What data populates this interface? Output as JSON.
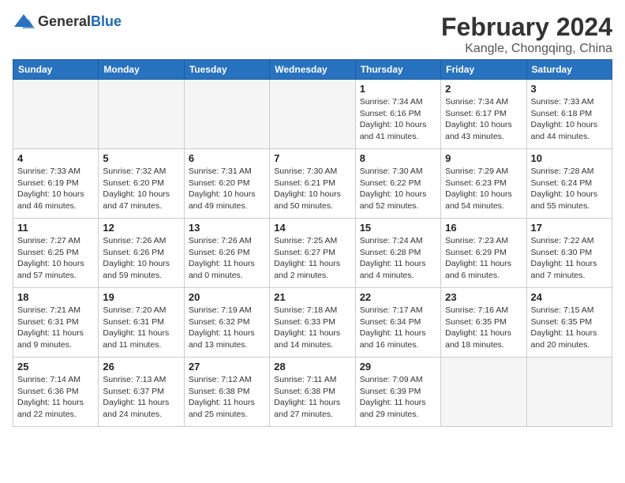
{
  "logo": {
    "general": "General",
    "blue": "Blue"
  },
  "title": "February 2024",
  "subtitle": "Kangle, Chongqing, China",
  "days_of_week": [
    "Sunday",
    "Monday",
    "Tuesday",
    "Wednesday",
    "Thursday",
    "Friday",
    "Saturday"
  ],
  "weeks": [
    [
      {
        "day": "",
        "info": ""
      },
      {
        "day": "",
        "info": ""
      },
      {
        "day": "",
        "info": ""
      },
      {
        "day": "",
        "info": ""
      },
      {
        "day": "1",
        "info": "Sunrise: 7:34 AM\nSunset: 6:16 PM\nDaylight: 10 hours and 41 minutes."
      },
      {
        "day": "2",
        "info": "Sunrise: 7:34 AM\nSunset: 6:17 PM\nDaylight: 10 hours and 43 minutes."
      },
      {
        "day": "3",
        "info": "Sunrise: 7:33 AM\nSunset: 6:18 PM\nDaylight: 10 hours and 44 minutes."
      }
    ],
    [
      {
        "day": "4",
        "info": "Sunrise: 7:33 AM\nSunset: 6:19 PM\nDaylight: 10 hours and 46 minutes."
      },
      {
        "day": "5",
        "info": "Sunrise: 7:32 AM\nSunset: 6:20 PM\nDaylight: 10 hours and 47 minutes."
      },
      {
        "day": "6",
        "info": "Sunrise: 7:31 AM\nSunset: 6:20 PM\nDaylight: 10 hours and 49 minutes."
      },
      {
        "day": "7",
        "info": "Sunrise: 7:30 AM\nSunset: 6:21 PM\nDaylight: 10 hours and 50 minutes."
      },
      {
        "day": "8",
        "info": "Sunrise: 7:30 AM\nSunset: 6:22 PM\nDaylight: 10 hours and 52 minutes."
      },
      {
        "day": "9",
        "info": "Sunrise: 7:29 AM\nSunset: 6:23 PM\nDaylight: 10 hours and 54 minutes."
      },
      {
        "day": "10",
        "info": "Sunrise: 7:28 AM\nSunset: 6:24 PM\nDaylight: 10 hours and 55 minutes."
      }
    ],
    [
      {
        "day": "11",
        "info": "Sunrise: 7:27 AM\nSunset: 6:25 PM\nDaylight: 10 hours and 57 minutes."
      },
      {
        "day": "12",
        "info": "Sunrise: 7:26 AM\nSunset: 6:26 PM\nDaylight: 10 hours and 59 minutes."
      },
      {
        "day": "13",
        "info": "Sunrise: 7:26 AM\nSunset: 6:26 PM\nDaylight: 11 hours and 0 minutes."
      },
      {
        "day": "14",
        "info": "Sunrise: 7:25 AM\nSunset: 6:27 PM\nDaylight: 11 hours and 2 minutes."
      },
      {
        "day": "15",
        "info": "Sunrise: 7:24 AM\nSunset: 6:28 PM\nDaylight: 11 hours and 4 minutes."
      },
      {
        "day": "16",
        "info": "Sunrise: 7:23 AM\nSunset: 6:29 PM\nDaylight: 11 hours and 6 minutes."
      },
      {
        "day": "17",
        "info": "Sunrise: 7:22 AM\nSunset: 6:30 PM\nDaylight: 11 hours and 7 minutes."
      }
    ],
    [
      {
        "day": "18",
        "info": "Sunrise: 7:21 AM\nSunset: 6:31 PM\nDaylight: 11 hours and 9 minutes."
      },
      {
        "day": "19",
        "info": "Sunrise: 7:20 AM\nSunset: 6:31 PM\nDaylight: 11 hours and 11 minutes."
      },
      {
        "day": "20",
        "info": "Sunrise: 7:19 AM\nSunset: 6:32 PM\nDaylight: 11 hours and 13 minutes."
      },
      {
        "day": "21",
        "info": "Sunrise: 7:18 AM\nSunset: 6:33 PM\nDaylight: 11 hours and 14 minutes."
      },
      {
        "day": "22",
        "info": "Sunrise: 7:17 AM\nSunset: 6:34 PM\nDaylight: 11 hours and 16 minutes."
      },
      {
        "day": "23",
        "info": "Sunrise: 7:16 AM\nSunset: 6:35 PM\nDaylight: 11 hours and 18 minutes."
      },
      {
        "day": "24",
        "info": "Sunrise: 7:15 AM\nSunset: 6:35 PM\nDaylight: 11 hours and 20 minutes."
      }
    ],
    [
      {
        "day": "25",
        "info": "Sunrise: 7:14 AM\nSunset: 6:36 PM\nDaylight: 11 hours and 22 minutes."
      },
      {
        "day": "26",
        "info": "Sunrise: 7:13 AM\nSunset: 6:37 PM\nDaylight: 11 hours and 24 minutes."
      },
      {
        "day": "27",
        "info": "Sunrise: 7:12 AM\nSunset: 6:38 PM\nDaylight: 11 hours and 25 minutes."
      },
      {
        "day": "28",
        "info": "Sunrise: 7:11 AM\nSunset: 6:38 PM\nDaylight: 11 hours and 27 minutes."
      },
      {
        "day": "29",
        "info": "Sunrise: 7:09 AM\nSunset: 6:39 PM\nDaylight: 11 hours and 29 minutes."
      },
      {
        "day": "",
        "info": ""
      },
      {
        "day": "",
        "info": ""
      }
    ]
  ]
}
